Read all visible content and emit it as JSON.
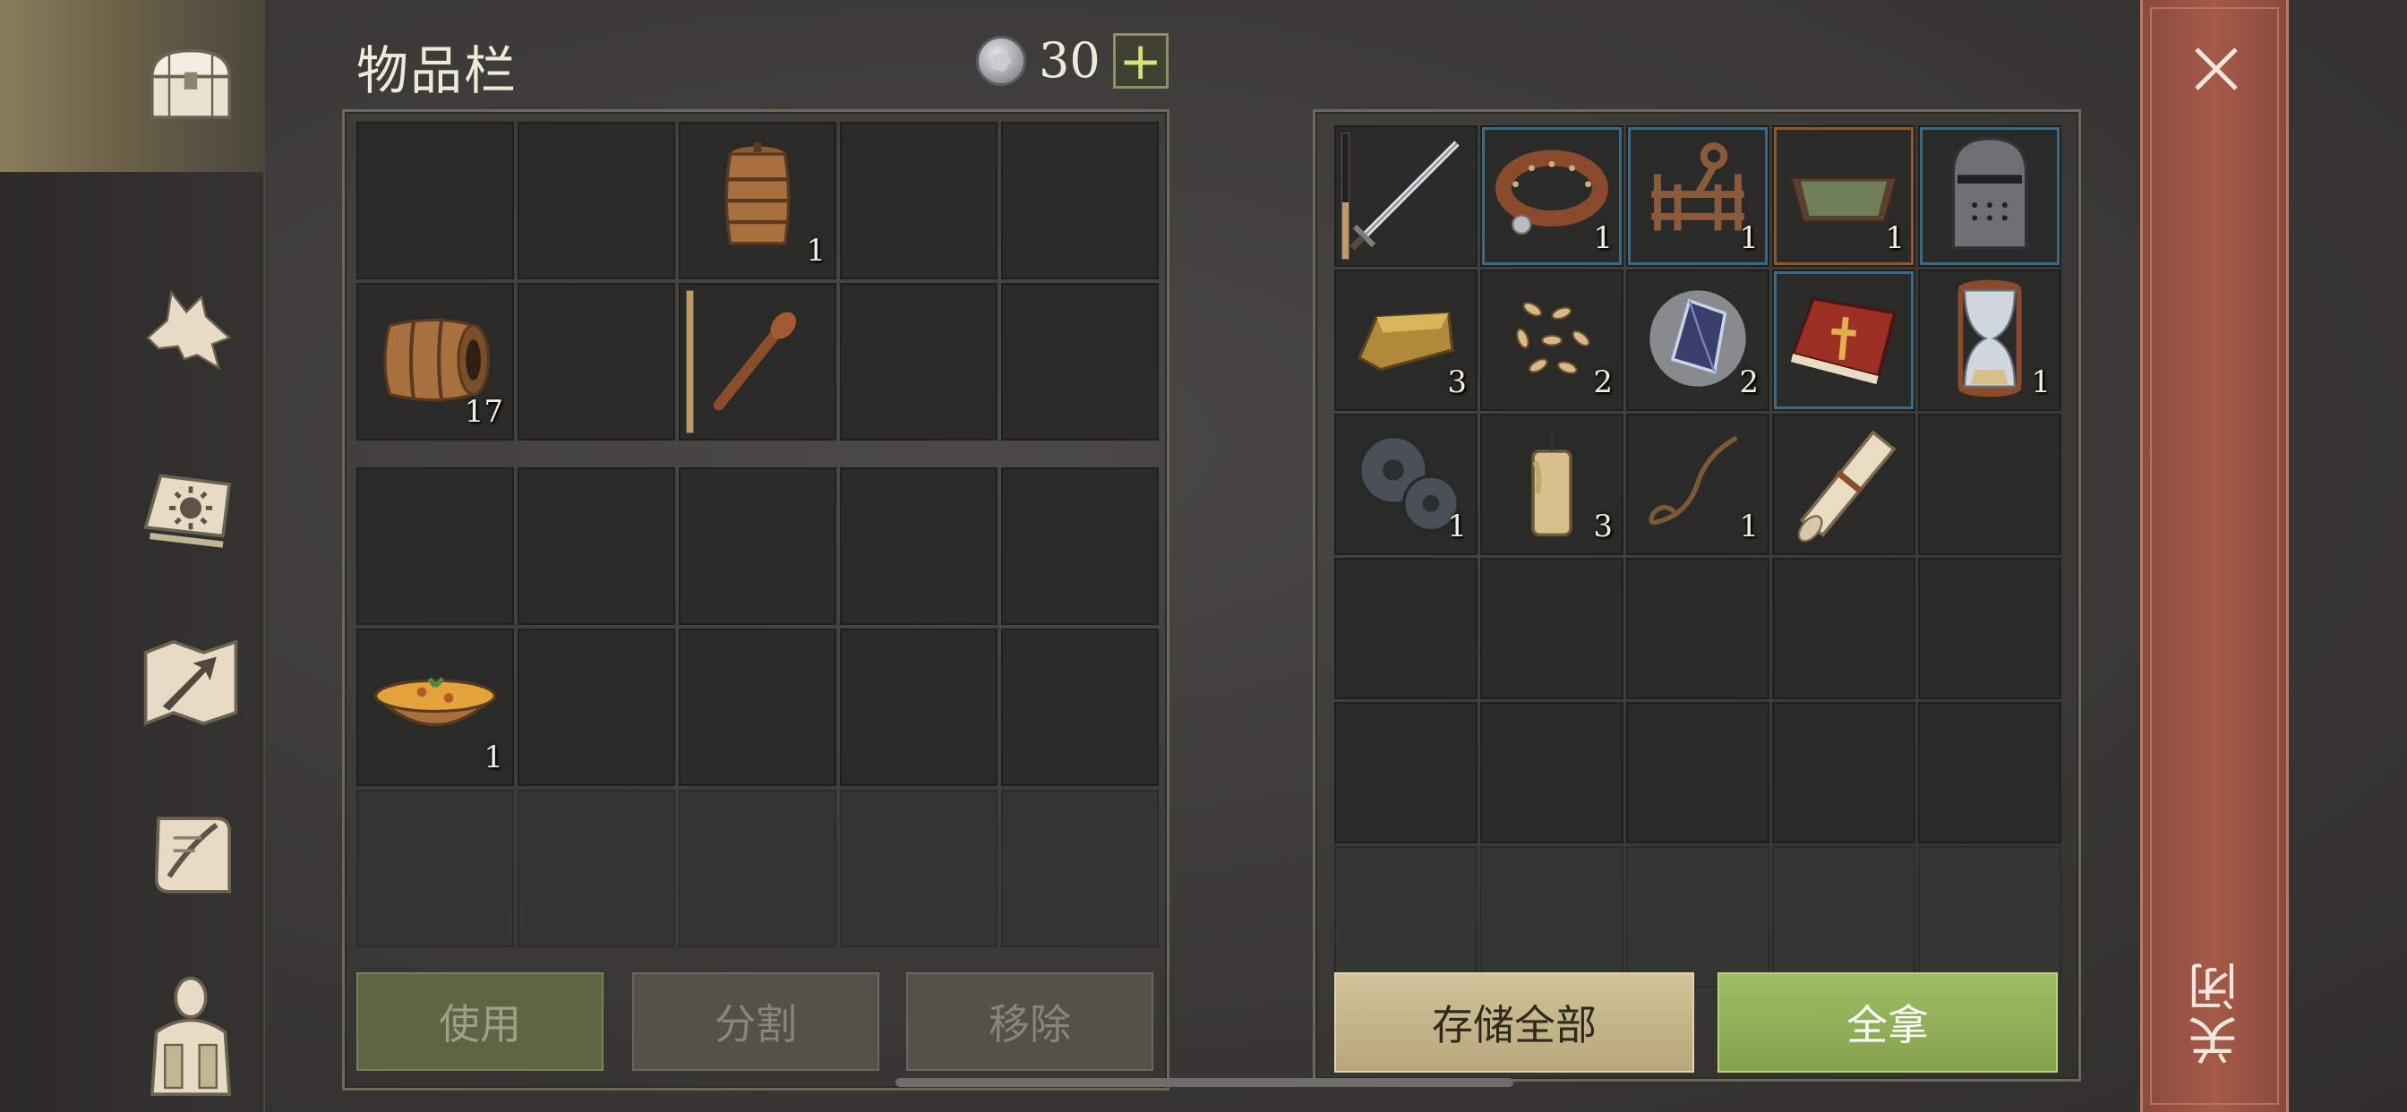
{
  "header": {
    "title": "物品栏",
    "currency_amount": "30",
    "plus_label": "+"
  },
  "sidebar": {
    "tabs": [
      {
        "icon": "chest-icon",
        "active": true
      },
      {
        "icon": "wolf-head-icon",
        "active": false
      },
      {
        "icon": "sun-book-icon",
        "active": false
      },
      {
        "icon": "map-arrow-icon",
        "active": false
      },
      {
        "icon": "scroll-quill-icon",
        "active": false
      },
      {
        "icon": "backpack-character-icon",
        "active": false
      }
    ]
  },
  "inventory": {
    "top_grid": [
      {
        "icon": ""
      },
      {
        "icon": ""
      },
      {
        "icon": "small-barrel-icon",
        "count": "1"
      },
      {
        "icon": ""
      },
      {
        "icon": ""
      },
      {
        "icon": "barrel-icon",
        "count": "17"
      },
      {
        "icon": ""
      },
      {
        "icon": "wooden-club-icon",
        "durability": 1.0
      },
      {
        "icon": ""
      },
      {
        "icon": ""
      }
    ],
    "bottom_grid": [
      {
        "icon": ""
      },
      {
        "icon": ""
      },
      {
        "icon": ""
      },
      {
        "icon": ""
      },
      {
        "icon": ""
      },
      {
        "icon": "stew-bowl-icon",
        "count": "1"
      },
      {
        "icon": ""
      },
      {
        "icon": ""
      },
      {
        "icon": ""
      },
      {
        "icon": ""
      },
      {
        "icon": ""
      },
      {
        "icon": ""
      },
      {
        "icon": ""
      },
      {
        "icon": ""
      },
      {
        "icon": ""
      }
    ],
    "buttons": {
      "use": "使用",
      "split": "分割",
      "remove": "移除"
    }
  },
  "storage": {
    "grid": [
      {
        "icon": "sword-icon",
        "durability": 0.45
      },
      {
        "icon": "leather-collar-icon",
        "count": "1",
        "frame": "blue"
      },
      {
        "icon": "rack-icon",
        "count": "1",
        "frame": "blue"
      },
      {
        "icon": "tray-icon",
        "count": "1",
        "frame": "orange"
      },
      {
        "icon": "knight-helmet-icon",
        "frame": "blue"
      },
      {
        "icon": "gold-ingot-icon",
        "count": "3"
      },
      {
        "icon": "seeds-icon",
        "count": "2"
      },
      {
        "icon": "crystal-icon",
        "count": "2"
      },
      {
        "icon": "red-book-icon",
        "frame": "blue"
      },
      {
        "icon": "hourglass-icon",
        "count": "1"
      },
      {
        "icon": "gear-icon",
        "count": "1"
      },
      {
        "icon": "candle-icon",
        "count": "3"
      },
      {
        "icon": "rope-icon",
        "count": "1"
      },
      {
        "icon": "paper-scroll-icon"
      },
      {
        "icon": ""
      },
      {
        "icon": ""
      },
      {
        "icon": ""
      },
      {
        "icon": ""
      },
      {
        "icon": ""
      },
      {
        "icon": ""
      },
      {
        "icon": ""
      },
      {
        "icon": ""
      },
      {
        "icon": ""
      },
      {
        "icon": ""
      },
      {
        "icon": ""
      },
      {
        "icon": ""
      },
      {
        "icon": ""
      },
      {
        "icon": ""
      },
      {
        "icon": ""
      },
      {
        "icon": ""
      }
    ],
    "buttons": {
      "store_all": "存储全部",
      "take_all": "全拿"
    }
  },
  "close": {
    "label": "关闭"
  }
}
